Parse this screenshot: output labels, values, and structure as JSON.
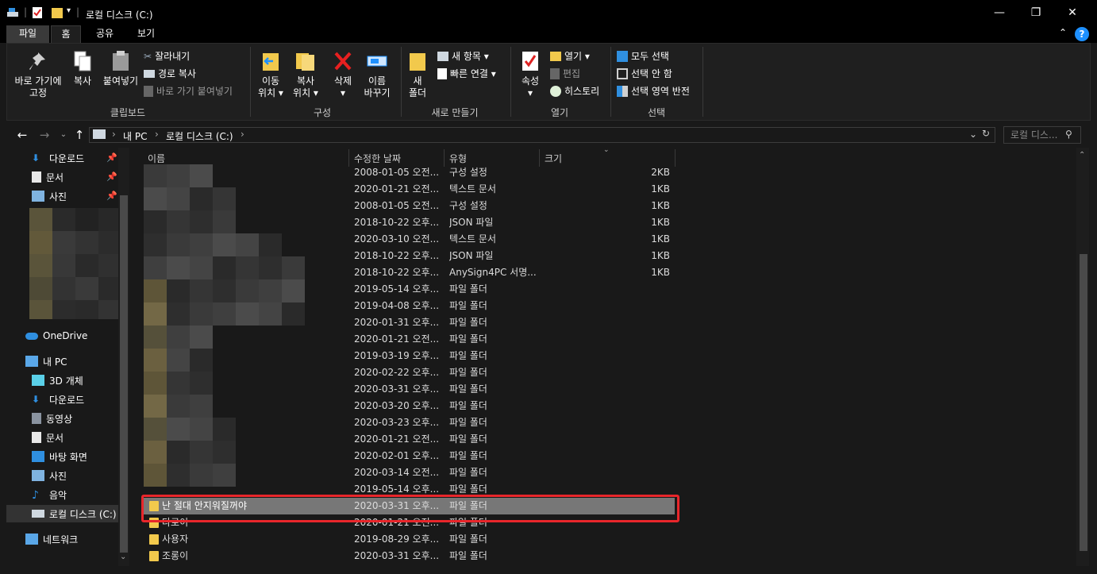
{
  "window": {
    "title": "로컬 디스크 (C:)",
    "minimize": "—",
    "maximize": "❐",
    "close": "✕",
    "help": "?"
  },
  "tabs": [
    "파일",
    "홈",
    "공유",
    "보기"
  ],
  "ribbon": {
    "clipboard": {
      "pin_label": "바로 가기에\n고정",
      "pin_line1": "바로 가기에",
      "pin_line2": "고정",
      "copy": "복사",
      "paste": "붙여넣기",
      "cut": "잘라내기",
      "copy_path": "경로 복사",
      "paste_shortcut": "바로 가기 붙여넣기",
      "group": "클립보드"
    },
    "organize": {
      "move_line1": "이동",
      "move_line2": "위치 ▾",
      "copy_line1": "복사",
      "copy_line2": "위치 ▾",
      "delete": "삭제",
      "delete_arrow": "▾",
      "rename_line1": "이름",
      "rename_line2": "바꾸기",
      "group": "구성"
    },
    "new": {
      "new_folder_line1": "새",
      "new_folder_line2": "폴더",
      "new_item": "새 항목 ▾",
      "easy_access": "빠른 연결 ▾",
      "group": "새로 만들기"
    },
    "open": {
      "properties": "속성",
      "properties_arrow": "▾",
      "open": "열기 ▾",
      "edit": "편집",
      "history": "히스토리",
      "group": "열기"
    },
    "select": {
      "select_all": "모두 선택",
      "select_none": "선택 안 함",
      "invert": "선택 영역 반전",
      "group": "선택"
    }
  },
  "address": {
    "crumbs": [
      "내 PC",
      "로컬 디스크 (C:)"
    ],
    "search_placeholder": "로컬 디스..."
  },
  "nav": {
    "quick": [
      {
        "label": "다운로드",
        "pinned": true
      },
      {
        "label": "문서",
        "pinned": true
      },
      {
        "label": "사진",
        "pinned": true
      }
    ],
    "onedrive": "OneDrive",
    "thispc": "내 PC",
    "pc_items": [
      "3D 개체",
      "다운로드",
      "동영상",
      "문서",
      "바탕 화면",
      "사진",
      "음악",
      "로컬 디스크 (C:)"
    ],
    "network": "네트워크"
  },
  "columns": {
    "name": "이름",
    "date": "수정한 날짜",
    "type": "유형",
    "size": "크기"
  },
  "files": [
    {
      "name": "",
      "date": "2008-01-05 오전...",
      "type": "구성 설정",
      "size": "2KB"
    },
    {
      "name": "",
      "date": "2020-01-21 오전...",
      "type": "텍스트 문서",
      "size": "1KB"
    },
    {
      "name": "",
      "date": "2008-01-05 오전...",
      "type": "구성 설정",
      "size": "1KB"
    },
    {
      "name": "",
      "date": "2018-10-22 오후...",
      "type": "JSON 파일",
      "size": "1KB"
    },
    {
      "name": "",
      "date": "2020-03-10 오전...",
      "type": "텍스트 문서",
      "size": "1KB"
    },
    {
      "name": "",
      "date": "2018-10-22 오후...",
      "type": "JSON 파일",
      "size": "1KB"
    },
    {
      "name": "",
      "date": "2018-10-22 오후...",
      "type": "AnySign4PC 서명...",
      "size": "1KB"
    },
    {
      "name": "",
      "date": "2019-05-14 오후...",
      "type": "파일 폴더",
      "size": ""
    },
    {
      "name": "",
      "date": "2019-04-08 오후...",
      "type": "파일 폴더",
      "size": ""
    },
    {
      "name": "",
      "date": "2020-01-31 오후...",
      "type": "파일 폴더",
      "size": ""
    },
    {
      "name": "",
      "date": "2020-01-21 오전...",
      "type": "파일 폴더",
      "size": ""
    },
    {
      "name": "",
      "date": "2019-03-19 오후...",
      "type": "파일 폴더",
      "size": ""
    },
    {
      "name": "",
      "date": "2020-02-22 오후...",
      "type": "파일 폴더",
      "size": ""
    },
    {
      "name": "",
      "date": "2020-03-31 오후...",
      "type": "파일 폴더",
      "size": ""
    },
    {
      "name": "",
      "date": "2020-03-20 오후...",
      "type": "파일 폴더",
      "size": ""
    },
    {
      "name": "",
      "date": "2020-03-23 오후...",
      "type": "파일 폴더",
      "size": ""
    },
    {
      "name": "",
      "date": "2020-01-21 오전...",
      "type": "파일 폴더",
      "size": ""
    },
    {
      "name": "",
      "date": "2020-02-01 오후...",
      "type": "파일 폴더",
      "size": ""
    },
    {
      "name": "",
      "date": "2020-03-14 오전...",
      "type": "파일 폴더",
      "size": ""
    },
    {
      "name": "",
      "date": "2019-05-14 오후...",
      "type": "파일 폴더",
      "size": ""
    },
    {
      "name": "난 절대 안지워질꺼야",
      "date": "2020-03-31 오후...",
      "type": "파일 폴더",
      "size": ""
    },
    {
      "name": "다로이",
      "date": "2020-01-21 오전...",
      "type": "파일 폴더",
      "size": ""
    },
    {
      "name": "사용자",
      "date": "2019-08-29 오후...",
      "type": "파일 폴더",
      "size": ""
    },
    {
      "name": "조롱이",
      "date": "2020-03-31 오후...",
      "type": "파일 폴더",
      "size": ""
    }
  ],
  "colors": {
    "highlight": "#777777",
    "redbox": "#e8262b",
    "folder": "#f2c94c",
    "accent": "#1e90ff"
  }
}
